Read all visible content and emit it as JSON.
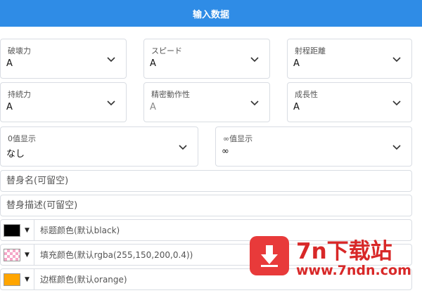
{
  "header": {
    "title": "输入数据"
  },
  "selects_row1": [
    {
      "label": "破壊力",
      "value": "A"
    },
    {
      "label": "スピード",
      "value": "A"
    },
    {
      "label": "射程距離",
      "value": "A"
    }
  ],
  "selects_row2": [
    {
      "label": "持続力",
      "value": "A"
    },
    {
      "label": "精密動作性",
      "value": "A"
    },
    {
      "label": "成長性",
      "value": "A"
    }
  ],
  "selects_row3": [
    {
      "label": "0值显示",
      "value": "なし"
    },
    {
      "label": "∞值显示",
      "value": "∞"
    }
  ],
  "inputs": {
    "stand_name_placeholder": "替身名(可留空)",
    "stand_desc_placeholder": "替身描述(可留空)"
  },
  "color_fields": [
    {
      "placeholder": "标题颜色(默认black)",
      "swatch": "#000000"
    },
    {
      "placeholder": "填充颜色(默认rgba(255,150,200,0.4))",
      "swatch": "rgba(255,150,200,0.4)"
    },
    {
      "placeholder": "边框颜色(默认orange)",
      "swatch": "#ffa500"
    }
  ],
  "watermark": {
    "title": "7n下载站",
    "url": "www.7ndn.com"
  },
  "colors": {
    "header": "#2f8ce6",
    "watermark": "#d82828"
  }
}
